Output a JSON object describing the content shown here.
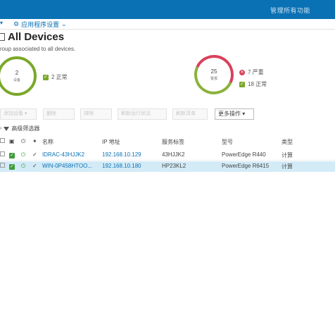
{
  "topbar": {
    "right_link": "管理所有功能"
  },
  "subbar": {
    "left_chevron": "▾",
    "settings_label": "应用程序设置"
  },
  "page": {
    "title": "All Devices",
    "subtitle": "roup associated to all devices."
  },
  "summary_left": {
    "count": "2",
    "count_label": "设备",
    "ok_text": "2 正常"
  },
  "summary_right": {
    "count": "25",
    "count_label": "警报",
    "critical_text": "7 严重",
    "ok_text": "18 正常"
  },
  "toolbar": {
    "btn1": "添加设备",
    "btn2": "删除",
    "btn3": "排除",
    "btn4": "刷新运行状况",
    "btn5": "刷新清单",
    "more_actions": "更多操作"
  },
  "filter": {
    "label": "高级筛选器"
  },
  "table": {
    "headers": {
      "name": "名称",
      "ip": "IP 地址",
      "service_tag": "服务标签",
      "model": "型号",
      "type": "类型"
    },
    "rows": [
      {
        "name": "IDRAC-43HJJK2",
        "ip": "192.168.10.129",
        "service_tag": "43HJJK2",
        "model": "PowerEdge R440",
        "type": "计算"
      },
      {
        "name": "WIN-0P458HTOO...",
        "ip": "192.168.10.180",
        "service_tag": "HP23KL2",
        "model": "PowerEdge R6415",
        "type": "计算"
      }
    ]
  },
  "colors": {
    "brand_blue": "#0a71b4",
    "ok_green": "#7aa82a",
    "critical_red": "#d9405b",
    "selected_row": "#d3ebf7"
  }
}
